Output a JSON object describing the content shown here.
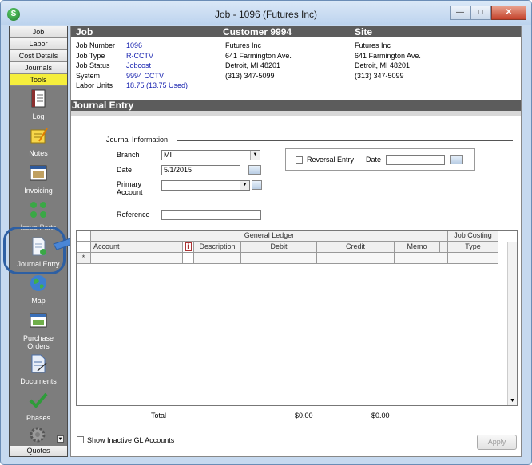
{
  "window": {
    "title": "Job - 1096 (Futures  Inc)"
  },
  "nav": {
    "tabs": [
      "Job",
      "Labor",
      "Cost Details",
      "Journals",
      "Tools"
    ],
    "items": [
      {
        "label": "Log",
        "icon": "log-book-icon"
      },
      {
        "label": "Notes",
        "icon": "notes-icon"
      },
      {
        "label": "Invoicing",
        "icon": "invoicing-icon"
      },
      {
        "label": "Issue Parts",
        "icon": "issue-parts-icon"
      },
      {
        "label": "Journal Entry",
        "icon": "journal-entry-icon"
      },
      {
        "label": "Map",
        "icon": "globe-map-icon"
      },
      {
        "label": "Purchase\nOrders",
        "icon": "purchase-orders-icon"
      },
      {
        "label": "Documents",
        "icon": "documents-icon"
      },
      {
        "label": "Phases",
        "icon": "checkmark-phases-icon"
      }
    ],
    "bottom": "Quotes"
  },
  "job": {
    "header_job": "Job",
    "header_customer": "Customer 9994",
    "header_site": "Site",
    "fields": [
      {
        "label": "Job Number",
        "value": "1096"
      },
      {
        "label": "Job Type",
        "value": "R-CCTV"
      },
      {
        "label": "Job Status",
        "value": "Jobcost"
      },
      {
        "label": "System",
        "value": "9994 CCTV"
      },
      {
        "label": "Labor Units",
        "value": "18.75 (13.75 Used)"
      }
    ],
    "customer": [
      "Futures  Inc",
      "641 Farmington Ave.",
      "Detroit, MI 48201",
      "(313) 347-5099"
    ],
    "site": [
      "Futures  Inc",
      "641 Farmington Ave.",
      "Detroit, MI 48201",
      "(313) 347-5099"
    ]
  },
  "journal": {
    "header": "Journal Entry",
    "group_label": "Journal Information",
    "branch_label": "Branch",
    "branch_value": "MI",
    "date_label": "Date",
    "date_value": "5/1/2015",
    "primary_label": "Primary\nAccount",
    "primary_value": "",
    "reference_label": "Reference",
    "reference_value": "",
    "reversal_label": "Reversal Entry",
    "reversal_checked": false,
    "reversal_date_label": "Date",
    "reversal_date_value": ""
  },
  "grid": {
    "group_general_ledger": "General Ledger",
    "group_job_costing": "Job Costing",
    "columns": [
      "Account",
      "Description",
      "Debit",
      "Credit",
      "Memo",
      "Type"
    ],
    "new_row_marker": "*"
  },
  "totals": {
    "label": "Total",
    "debit": "$0.00",
    "credit": "$0.00"
  },
  "footer": {
    "show_inactive_label": "Show Inactive GL Accounts",
    "show_inactive_checked": false,
    "apply_label": "Apply"
  },
  "colors": {
    "nav_active": "#f5ee3c",
    "header_bar": "#5c5c5c",
    "value_blue": "#1a25b0",
    "highlight": "#2d5fa3"
  }
}
